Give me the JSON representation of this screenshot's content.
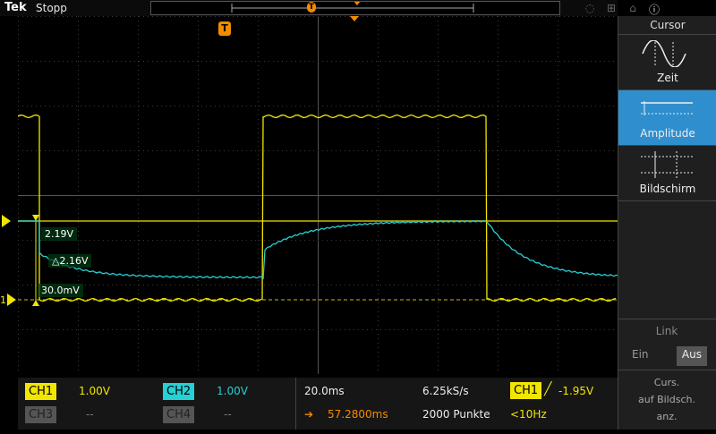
{
  "header": {
    "brand": "Tek",
    "status": "Stopp"
  },
  "trigger_marker": "T",
  "side_menu": {
    "title": "Cursor",
    "items": [
      {
        "label": "Zeit",
        "active": false
      },
      {
        "label": "Amplitude",
        "active": true
      },
      {
        "label": "Bildschirm",
        "active": false
      }
    ],
    "link_title": "Link",
    "link_on": "Ein",
    "link_off": "Aus",
    "link_selected": "Aus",
    "curs_menu_line1": "Curs.",
    "curs_menu_line2": "auf Bildsch.",
    "curs_menu_line3": "anz."
  },
  "cursor_readouts": {
    "upper": "2.19V",
    "delta": "△2.16V",
    "lower": "30.0mV"
  },
  "channels": {
    "ch1": {
      "label": "CH1",
      "scale": "1.00V"
    },
    "ch2": {
      "label": "CH2",
      "scale": "1.00V"
    },
    "ch3": {
      "label": "CH3",
      "scale": "--"
    },
    "ch4": {
      "label": "CH4",
      "scale": "--"
    }
  },
  "timebase": {
    "scale": "20.0ms",
    "sample_rate": "6.25kS/s",
    "position": "57.2800ms",
    "points": "2000 Punkte"
  },
  "trigger": {
    "source": "CH1",
    "level": "-1.95V",
    "freq": "<10Hz"
  },
  "colors": {
    "ch1": "#f2e600",
    "ch2": "#27d0d4",
    "accent": "#2f8fce"
  },
  "ground_marker": "1"
}
